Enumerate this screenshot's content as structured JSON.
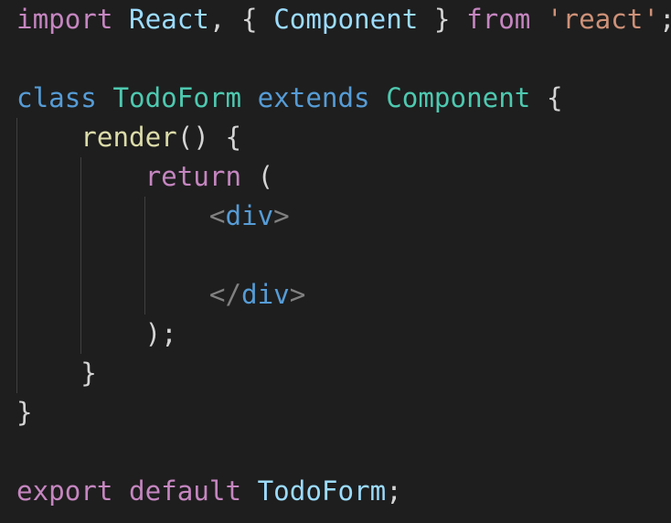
{
  "editor": {
    "lines": [
      [
        {
          "text": "import",
          "kind": "kw"
        },
        {
          "text": " ",
          "kind": "punc"
        },
        {
          "text": "React",
          "kind": "var"
        },
        {
          "text": ", { ",
          "kind": "punc"
        },
        {
          "text": "Component",
          "kind": "var"
        },
        {
          "text": " } ",
          "kind": "punc"
        },
        {
          "text": "from",
          "kind": "kw"
        },
        {
          "text": " ",
          "kind": "punc"
        },
        {
          "text": "'react'",
          "kind": "str"
        },
        {
          "text": ";",
          "kind": "punc"
        }
      ],
      [],
      [
        {
          "text": "class",
          "kind": "storage"
        },
        {
          "text": " ",
          "kind": "punc"
        },
        {
          "text": "TodoForm",
          "kind": "class"
        },
        {
          "text": " ",
          "kind": "punc"
        },
        {
          "text": "extends",
          "kind": "storage"
        },
        {
          "text": " ",
          "kind": "punc"
        },
        {
          "text": "Component",
          "kind": "class"
        },
        {
          "text": " {",
          "kind": "punc"
        }
      ],
      [
        {
          "text": "    ",
          "kind": "punc"
        },
        {
          "text": "render",
          "kind": "func"
        },
        {
          "text": "() {",
          "kind": "punc"
        }
      ],
      [
        {
          "text": "        ",
          "kind": "punc"
        },
        {
          "text": "return",
          "kind": "kw"
        },
        {
          "text": " (",
          "kind": "punc"
        }
      ],
      [
        {
          "text": "            ",
          "kind": "punc"
        },
        {
          "text": "<",
          "kind": "tagpunc"
        },
        {
          "text": "div",
          "kind": "tag"
        },
        {
          "text": ">",
          "kind": "tagpunc"
        }
      ],
      [],
      [
        {
          "text": "            ",
          "kind": "punc"
        },
        {
          "text": "</",
          "kind": "tagpunc"
        },
        {
          "text": "div",
          "kind": "tag"
        },
        {
          "text": ">",
          "kind": "tagpunc"
        }
      ],
      [
        {
          "text": "        ",
          "kind": "punc"
        },
        {
          "text": ");",
          "kind": "punc"
        }
      ],
      [
        {
          "text": "    ",
          "kind": "punc"
        },
        {
          "text": "}",
          "kind": "punc"
        }
      ],
      [
        {
          "text": "}",
          "kind": "punc"
        }
      ],
      [],
      [
        {
          "text": "export",
          "kind": "kw"
        },
        {
          "text": " ",
          "kind": "punc"
        },
        {
          "text": "default",
          "kind": "kw"
        },
        {
          "text": " ",
          "kind": "punc"
        },
        {
          "text": "TodoForm",
          "kind": "var"
        },
        {
          "text": ";",
          "kind": "punc"
        }
      ]
    ]
  },
  "colors": {
    "background": "#1e1e1e",
    "keyword": "#c586c0",
    "storage": "#569cd6",
    "variable": "#9cdcfe",
    "class": "#4ec9b0",
    "function": "#dcdcaa",
    "string": "#ce9178",
    "punctuation": "#d4d4d4",
    "tag_bracket": "#808080",
    "tag_name": "#569cd6",
    "indent_guide": "#404040"
  }
}
